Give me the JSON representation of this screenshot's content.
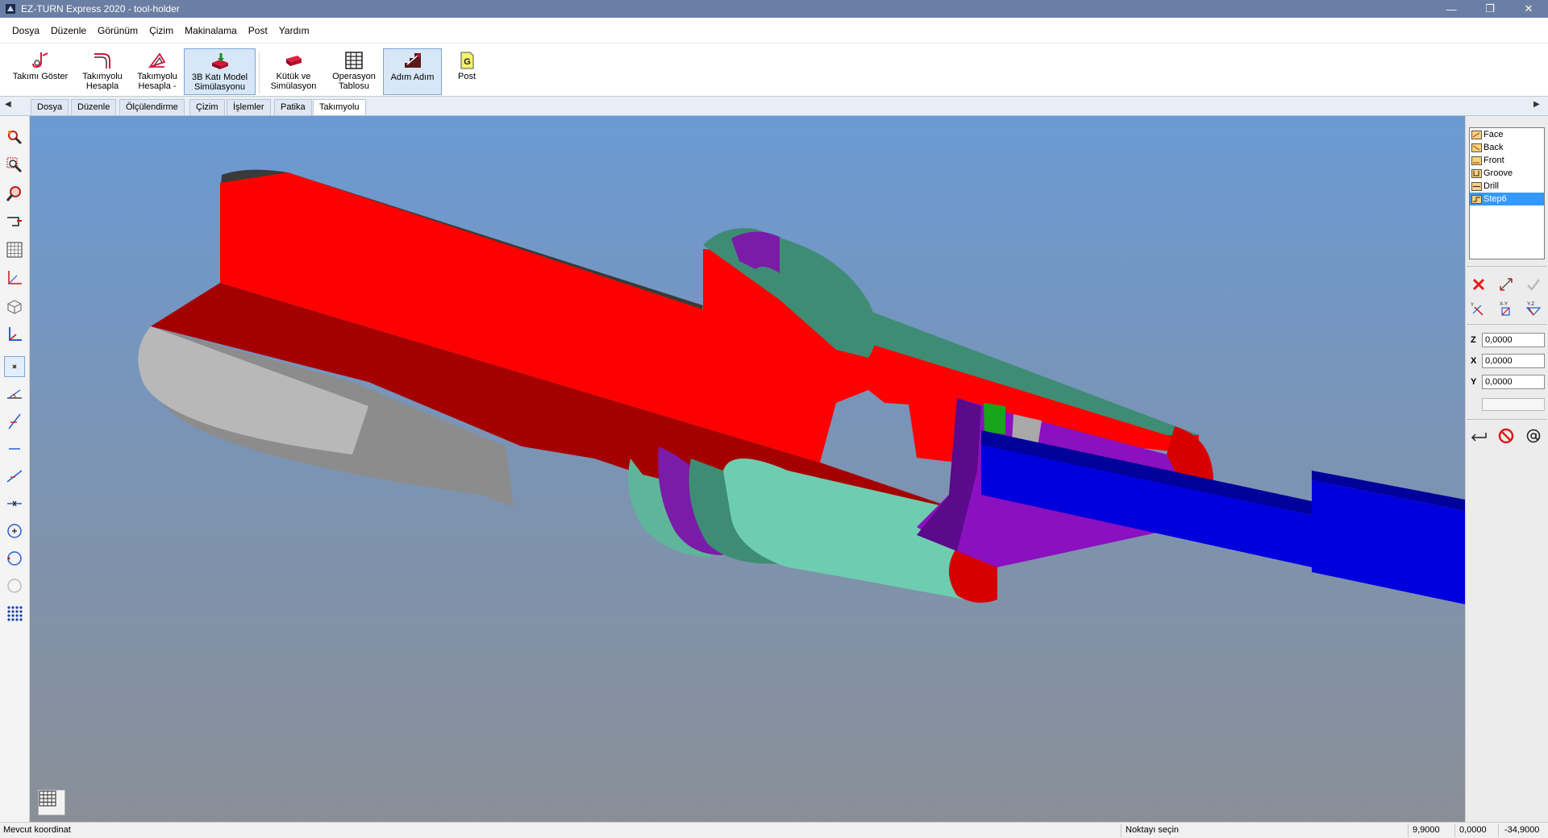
{
  "window": {
    "title": "EZ-TURN Express 2020 - tool-holder",
    "controls": {
      "minimize": "—",
      "restore": "❐",
      "close": "✕"
    }
  },
  "menu": [
    "Dosya",
    "Düzenle",
    "Görünüm",
    "Çizim",
    "Makinalama",
    "Post",
    "Yardım"
  ],
  "ribbon": {
    "buttons": [
      {
        "label": "Takımı Göster",
        "icon": "show-tool-icon"
      },
      {
        "label": "Takımyolu\nHesapla",
        "icon": "compute-toolpath-icon"
      },
      {
        "label": "Takımyolu\nHesapla -",
        "icon": "compute-toolpath-all-icon"
      },
      {
        "label": "3B Katı Model\nSimülasyonu",
        "icon": "solid-simulation-icon",
        "active": true
      },
      {
        "label": "Kütük ve\nSimülasyon",
        "icon": "stock-simulation-icon"
      },
      {
        "label": "Operasyon\nTablosu",
        "icon": "operation-table-icon"
      },
      {
        "label": "Adım Adım",
        "icon": "step-by-step-icon",
        "active": true
      },
      {
        "label": "Post",
        "icon": "post-g-icon",
        "glyph": "G"
      }
    ]
  },
  "tabs": [
    "Dosya",
    "Düzenle",
    "Ölçülendirme",
    "Çizim",
    "İşlemler",
    "Patika",
    "Takımyolu"
  ],
  "tabs_active": "Takımyolu",
  "operations": [
    {
      "label": "Face",
      "selected": false
    },
    {
      "label": "Back",
      "selected": false
    },
    {
      "label": "Front",
      "selected": false
    },
    {
      "label": "Groove",
      "selected": false
    },
    {
      "label": "Drill",
      "selected": false
    },
    {
      "label": "Step6",
      "selected": true
    }
  ],
  "coords": {
    "z_label": "Z",
    "z_value": "0,0000",
    "x_label": "X",
    "x_value": "0,0000",
    "y_label": "Y",
    "y_value": "0,0000"
  },
  "status": {
    "left": "Mevcut koordinat",
    "prompt": "Noktayı seçin",
    "coord1": "9,9000",
    "coord2": "0,0000",
    "coord3": "-34,9000"
  },
  "colors": {
    "model_red": "#ff0000",
    "model_dark_red": "#a00000",
    "model_teal": "#66c9a8",
    "model_purple": "#8a10c0",
    "tool_blue": "#0000dd",
    "viewport_top": "#6b9ad3",
    "viewport_bottom": "#8a8f97",
    "selection": "#3399ff"
  }
}
